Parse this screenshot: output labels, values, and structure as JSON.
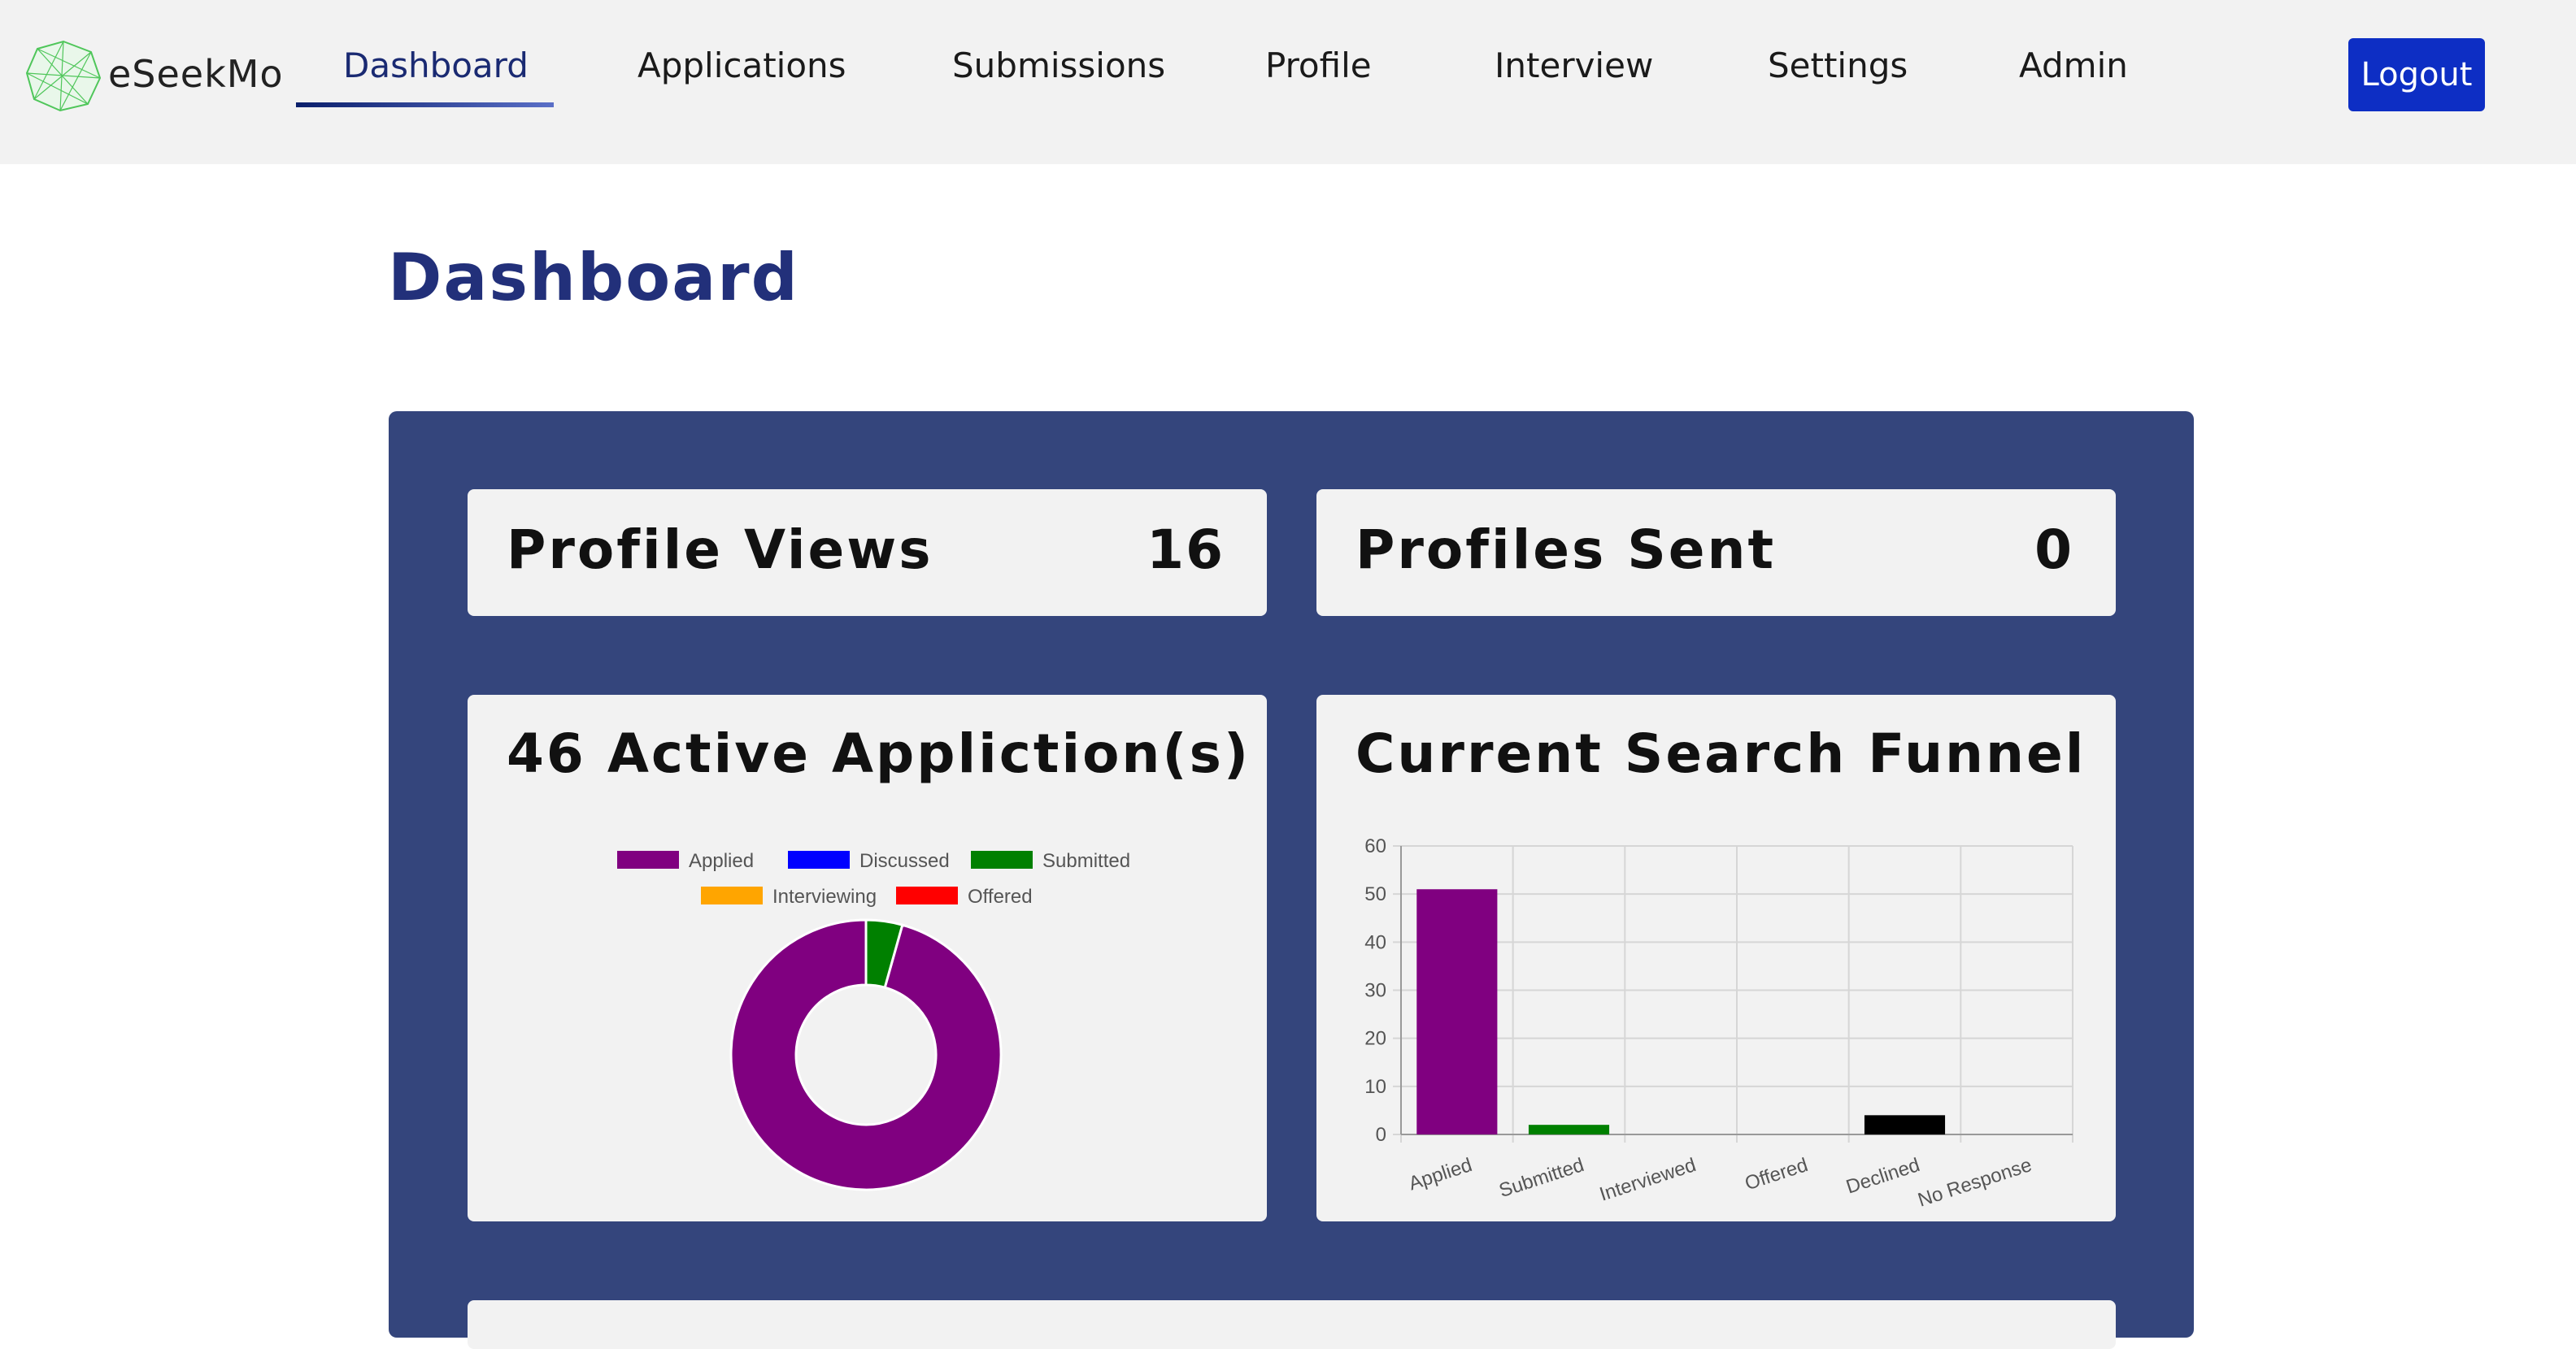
{
  "app": {
    "brand": "eSeekMo",
    "nav": [
      "Dashboard",
      "Applications",
      "Submissions",
      "Profile",
      "Interview",
      "Settings",
      "Admin"
    ],
    "active_nav": "Dashboard",
    "logout_label": "Logout"
  },
  "page": {
    "title": "Dashboard"
  },
  "stats": {
    "profile_views_label": "Profile Views",
    "profile_views_value": "16",
    "profiles_sent_label": "Profiles Sent",
    "profiles_sent_value": "0"
  },
  "cards": {
    "active_title": "46 Active Appliction(s)",
    "funnel_title": "Current Search Funnel"
  },
  "chart_data": [
    {
      "type": "pie",
      "donut": true,
      "legend": "top",
      "categories": [
        "Applied",
        "Discussed",
        "Submitted",
        "Interviewing",
        "Offered"
      ],
      "values": [
        44,
        0,
        2,
        0,
        0
      ],
      "colors": [
        "#800080",
        "#0000ff",
        "#008000",
        "#ffa500",
        "#ff0000"
      ]
    },
    {
      "type": "bar",
      "categories": [
        "Applied",
        "Submitted",
        "Interviewed",
        "Offered",
        "Declined",
        "No Response"
      ],
      "values": [
        51,
        2,
        0,
        0,
        4,
        0
      ],
      "colors": [
        "#800080",
        "#008000",
        "#cccccc",
        "#cccccc",
        "#000000",
        "#ffffff"
      ],
      "ylim": [
        0,
        60
      ],
      "yticks": [
        0,
        10,
        20,
        30,
        40,
        50,
        60
      ],
      "grid": true
    }
  ],
  "colors": {
    "accent": "#0d2ec4",
    "panel": "#34457c",
    "title": "#22307a"
  }
}
